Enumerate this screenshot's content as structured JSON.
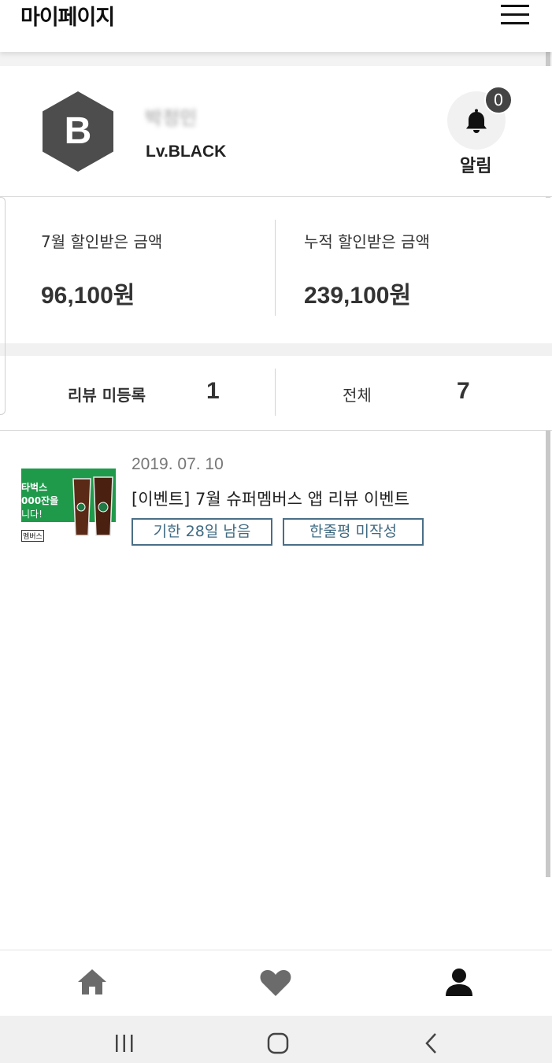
{
  "header": {
    "title": "마이페이지",
    "menu_icon": "hamburger-menu-icon"
  },
  "profile": {
    "badge_letter": "B",
    "name": "박정민",
    "level": "Lv.BLACK",
    "notification": {
      "count": "0",
      "label": "알림",
      "icon": "bell-icon"
    }
  },
  "discount": {
    "monthly_label": "7월 할인받은 금액",
    "monthly_value": "96,100원",
    "total_label": "누적 할인받은 금액",
    "total_value": "239,100원"
  },
  "review_tabs": {
    "unregistered_label": "리뷰 미등록",
    "unregistered_count": "1",
    "all_label": "전체",
    "all_count": "7"
  },
  "reviews": [
    {
      "date": "2019. 07. 10",
      "title": "[이벤트] 7월 슈퍼멤버스 앱 리뷰 이벤트",
      "thumb_lines": [
        "타벅스",
        "000잔을",
        "니다!"
      ],
      "thumb_logo": "멤버스",
      "tags": [
        "기한 28일 남음",
        "한줄평 미작성"
      ]
    }
  ],
  "bottom_nav": {
    "items": [
      {
        "icon": "home-icon",
        "active": false
      },
      {
        "icon": "heart-icon",
        "active": false
      },
      {
        "icon": "user-icon",
        "active": true
      }
    ]
  },
  "system_nav": {
    "icons": [
      "recent-apps-icon",
      "home-circle-icon",
      "back-icon"
    ]
  },
  "colors": {
    "tag_border": "#4a6e85",
    "badge": "#4d4d4d",
    "thumb_green": "#1f9a4b"
  }
}
